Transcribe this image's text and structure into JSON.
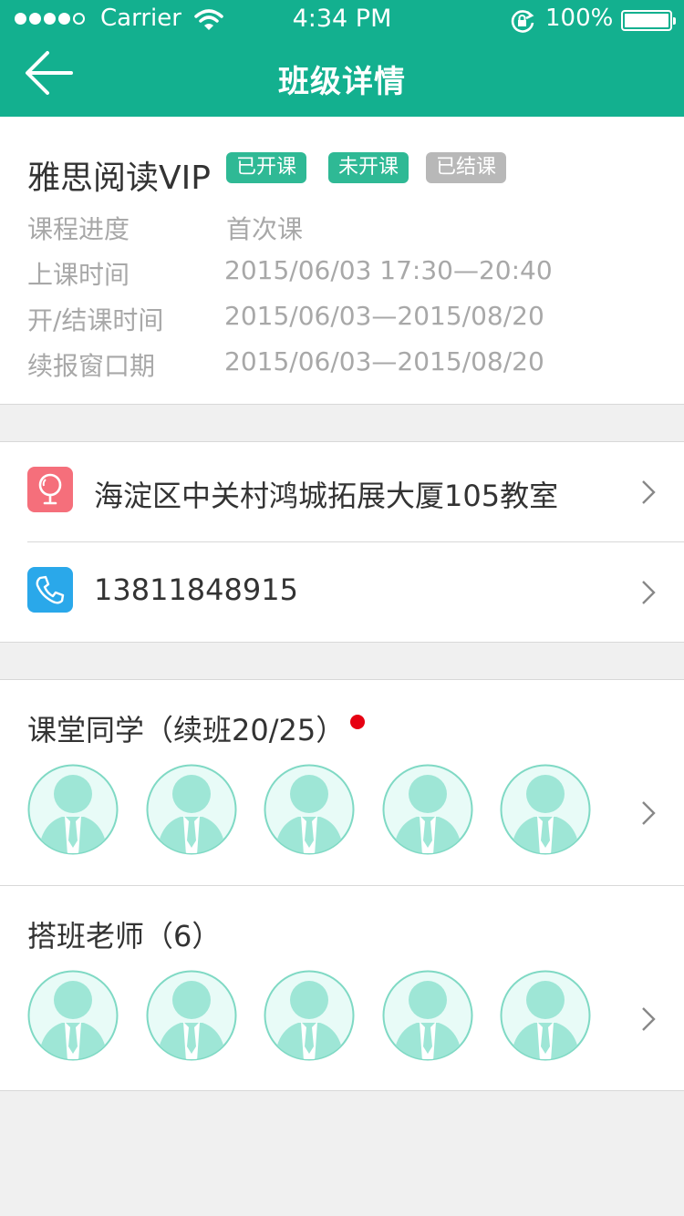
{
  "status_bar": {
    "carrier": "Carrier",
    "time": "4:34 PM",
    "battery": "100%"
  },
  "nav": {
    "title": "班级详情",
    "back_icon": "arrow-left-icon"
  },
  "course": {
    "name": "雅思阅读VIP",
    "tags": [
      "已开课",
      "未开课",
      "已结课"
    ],
    "rows": [
      {
        "label": "课程进度",
        "value": "首次课"
      },
      {
        "label": "上课时间",
        "value": "2015/06/03 17:30—20:40"
      },
      {
        "label": "开/结课时间",
        "value": "2015/06/03—2015/08/20"
      },
      {
        "label": "续报窗口期",
        "value": "2015/06/03—2015/08/20"
      }
    ]
  },
  "contact": {
    "address": "海淀区中关村鸿城拓展大厦105教室",
    "address_icon": "location-pin-icon",
    "phone": "13811848915",
    "phone_icon": "phone-icon"
  },
  "classmates": {
    "title": "课堂同学（续班20/25）",
    "avatar_count": 5
  },
  "teachers": {
    "title": "搭班老师（6）",
    "avatar_count": 5
  },
  "colors": {
    "brand": "#13b08f",
    "tag_green": "#2fb995",
    "tag_gray": "#b8b8b8",
    "address_icon_bg": "#f56f7b",
    "phone_icon_bg": "#2aa8ea",
    "avatar": "#9ee6d6",
    "notification_dot": "#e60012"
  }
}
